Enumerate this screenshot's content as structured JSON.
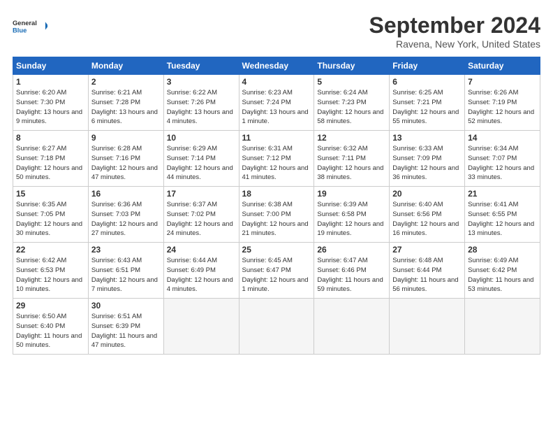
{
  "header": {
    "logo_text_general": "General",
    "logo_text_blue": "Blue",
    "month_title": "September 2024",
    "location": "Ravena, New York, United States"
  },
  "days_of_week": [
    "Sunday",
    "Monday",
    "Tuesday",
    "Wednesday",
    "Thursday",
    "Friday",
    "Saturday"
  ],
  "weeks": [
    [
      {
        "day": "1",
        "sunrise": "6:20 AM",
        "sunset": "7:30 PM",
        "daylight": "13 hours and 9 minutes."
      },
      {
        "day": "2",
        "sunrise": "6:21 AM",
        "sunset": "7:28 PM",
        "daylight": "13 hours and 6 minutes."
      },
      {
        "day": "3",
        "sunrise": "6:22 AM",
        "sunset": "7:26 PM",
        "daylight": "13 hours and 4 minutes."
      },
      {
        "day": "4",
        "sunrise": "6:23 AM",
        "sunset": "7:24 PM",
        "daylight": "13 hours and 1 minute."
      },
      {
        "day": "5",
        "sunrise": "6:24 AM",
        "sunset": "7:23 PM",
        "daylight": "12 hours and 58 minutes."
      },
      {
        "day": "6",
        "sunrise": "6:25 AM",
        "sunset": "7:21 PM",
        "daylight": "12 hours and 55 minutes."
      },
      {
        "day": "7",
        "sunrise": "6:26 AM",
        "sunset": "7:19 PM",
        "daylight": "12 hours and 52 minutes."
      }
    ],
    [
      {
        "day": "8",
        "sunrise": "6:27 AM",
        "sunset": "7:18 PM",
        "daylight": "12 hours and 50 minutes."
      },
      {
        "day": "9",
        "sunrise": "6:28 AM",
        "sunset": "7:16 PM",
        "daylight": "12 hours and 47 minutes."
      },
      {
        "day": "10",
        "sunrise": "6:29 AM",
        "sunset": "7:14 PM",
        "daylight": "12 hours and 44 minutes."
      },
      {
        "day": "11",
        "sunrise": "6:31 AM",
        "sunset": "7:12 PM",
        "daylight": "12 hours and 41 minutes."
      },
      {
        "day": "12",
        "sunrise": "6:32 AM",
        "sunset": "7:11 PM",
        "daylight": "12 hours and 38 minutes."
      },
      {
        "day": "13",
        "sunrise": "6:33 AM",
        "sunset": "7:09 PM",
        "daylight": "12 hours and 36 minutes."
      },
      {
        "day": "14",
        "sunrise": "6:34 AM",
        "sunset": "7:07 PM",
        "daylight": "12 hours and 33 minutes."
      }
    ],
    [
      {
        "day": "15",
        "sunrise": "6:35 AM",
        "sunset": "7:05 PM",
        "daylight": "12 hours and 30 minutes."
      },
      {
        "day": "16",
        "sunrise": "6:36 AM",
        "sunset": "7:03 PM",
        "daylight": "12 hours and 27 minutes."
      },
      {
        "day": "17",
        "sunrise": "6:37 AM",
        "sunset": "7:02 PM",
        "daylight": "12 hours and 24 minutes."
      },
      {
        "day": "18",
        "sunrise": "6:38 AM",
        "sunset": "7:00 PM",
        "daylight": "12 hours and 21 minutes."
      },
      {
        "day": "19",
        "sunrise": "6:39 AM",
        "sunset": "6:58 PM",
        "daylight": "12 hours and 19 minutes."
      },
      {
        "day": "20",
        "sunrise": "6:40 AM",
        "sunset": "6:56 PM",
        "daylight": "12 hours and 16 minutes."
      },
      {
        "day": "21",
        "sunrise": "6:41 AM",
        "sunset": "6:55 PM",
        "daylight": "12 hours and 13 minutes."
      }
    ],
    [
      {
        "day": "22",
        "sunrise": "6:42 AM",
        "sunset": "6:53 PM",
        "daylight": "12 hours and 10 minutes."
      },
      {
        "day": "23",
        "sunrise": "6:43 AM",
        "sunset": "6:51 PM",
        "daylight": "12 hours and 7 minutes."
      },
      {
        "day": "24",
        "sunrise": "6:44 AM",
        "sunset": "6:49 PM",
        "daylight": "12 hours and 4 minutes."
      },
      {
        "day": "25",
        "sunrise": "6:45 AM",
        "sunset": "6:47 PM",
        "daylight": "12 hours and 1 minute."
      },
      {
        "day": "26",
        "sunrise": "6:47 AM",
        "sunset": "6:46 PM",
        "daylight": "11 hours and 59 minutes."
      },
      {
        "day": "27",
        "sunrise": "6:48 AM",
        "sunset": "6:44 PM",
        "daylight": "11 hours and 56 minutes."
      },
      {
        "day": "28",
        "sunrise": "6:49 AM",
        "sunset": "6:42 PM",
        "daylight": "11 hours and 53 minutes."
      }
    ],
    [
      {
        "day": "29",
        "sunrise": "6:50 AM",
        "sunset": "6:40 PM",
        "daylight": "11 hours and 50 minutes."
      },
      {
        "day": "30",
        "sunrise": "6:51 AM",
        "sunset": "6:39 PM",
        "daylight": "11 hours and 47 minutes."
      },
      null,
      null,
      null,
      null,
      null
    ]
  ]
}
